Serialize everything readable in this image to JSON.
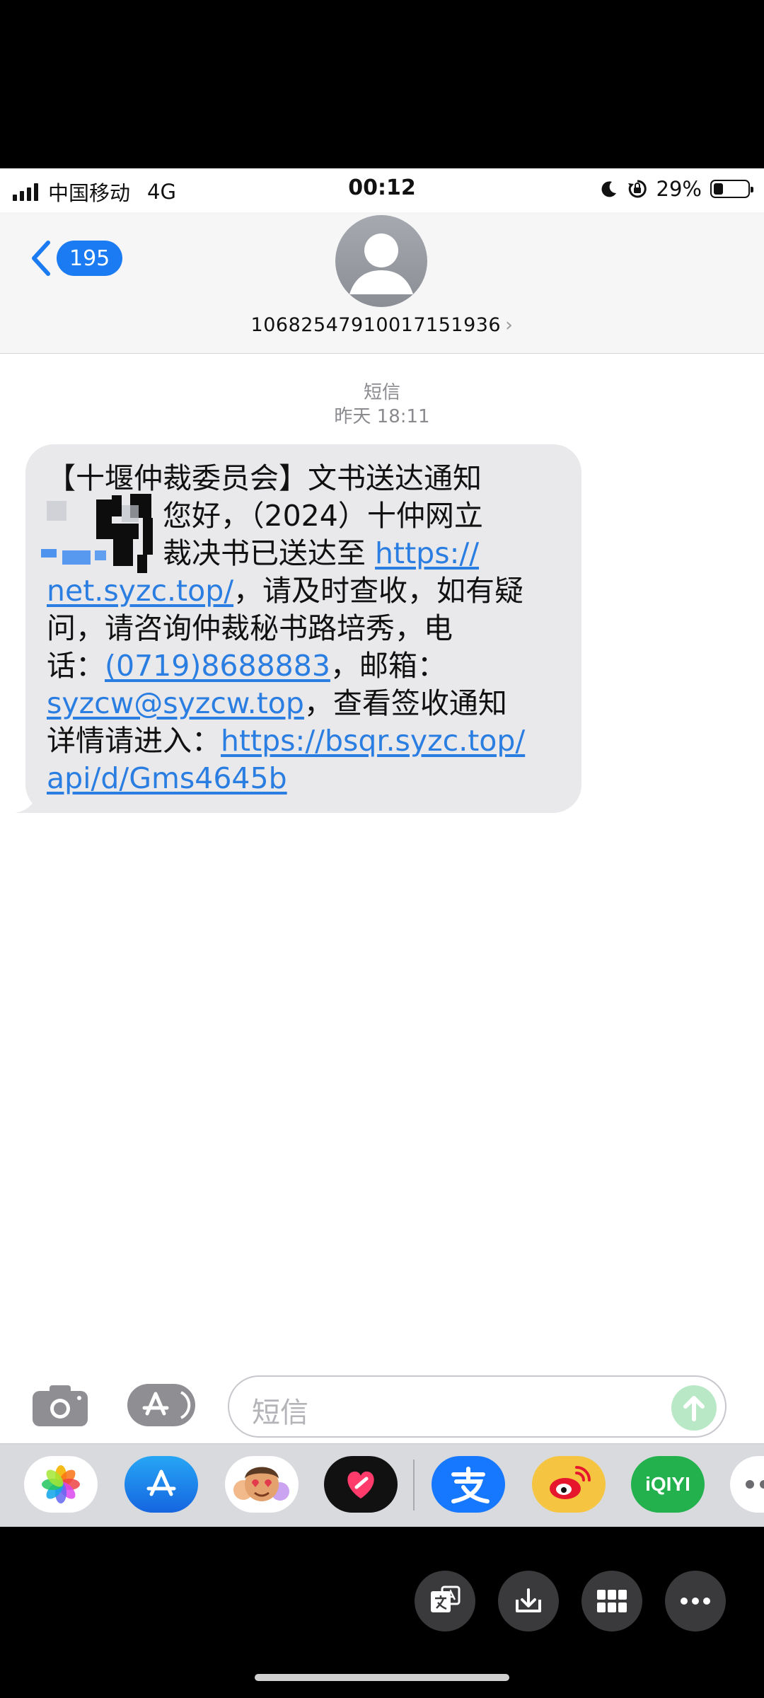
{
  "status_bar": {
    "carrier": "中国移动",
    "network": "4G",
    "time": "00:12",
    "battery_percent": "29%",
    "battery_level": 0.29
  },
  "header": {
    "back_badge": "195",
    "contact_number": "10682547910017151936",
    "chevron": "›"
  },
  "conversation": {
    "service_label": "短信",
    "timestamp": "昨天 18:11",
    "message": {
      "line1": "【十堰仲裁委员会】文书送达通知",
      "line2": "您好，（2024）十仲网立",
      "line3_text": "裁决书已送达至 ",
      "line3_link": "https://",
      "line4_link": "net.syzc.top/",
      "line4_text": "，请及时查收，如有疑",
      "line5": "问，请咨询仲裁秘书路培秀，电",
      "line6_text": "话：",
      "line6_link": "(0719)8688883",
      "line6_tail": "，邮箱：",
      "line7_link": "syzcw@syzcw.top",
      "line7_text": "，查看签收通知",
      "line8_text": "详情请进入：",
      "line8_link": "https://bsqr.syzc.top/",
      "line9_link": "api/d/Gms4645b"
    }
  },
  "input": {
    "placeholder": "短信"
  },
  "app_drawer": {
    "apps": [
      "photos-icon",
      "app-store-icon",
      "memoji-icon",
      "digital-touch-icon",
      "alipay-icon",
      "weibo-icon",
      "iqiyi-icon",
      "more-icon"
    ],
    "iqiyi_label": "iQIYI"
  },
  "toolbar": {
    "buttons": [
      "translate-icon",
      "download-icon",
      "grid-icon",
      "more-icon"
    ]
  },
  "colors": {
    "link": "#2a7de1",
    "badge": "#1a7bf2",
    "bubble": "#e9e9eb"
  }
}
